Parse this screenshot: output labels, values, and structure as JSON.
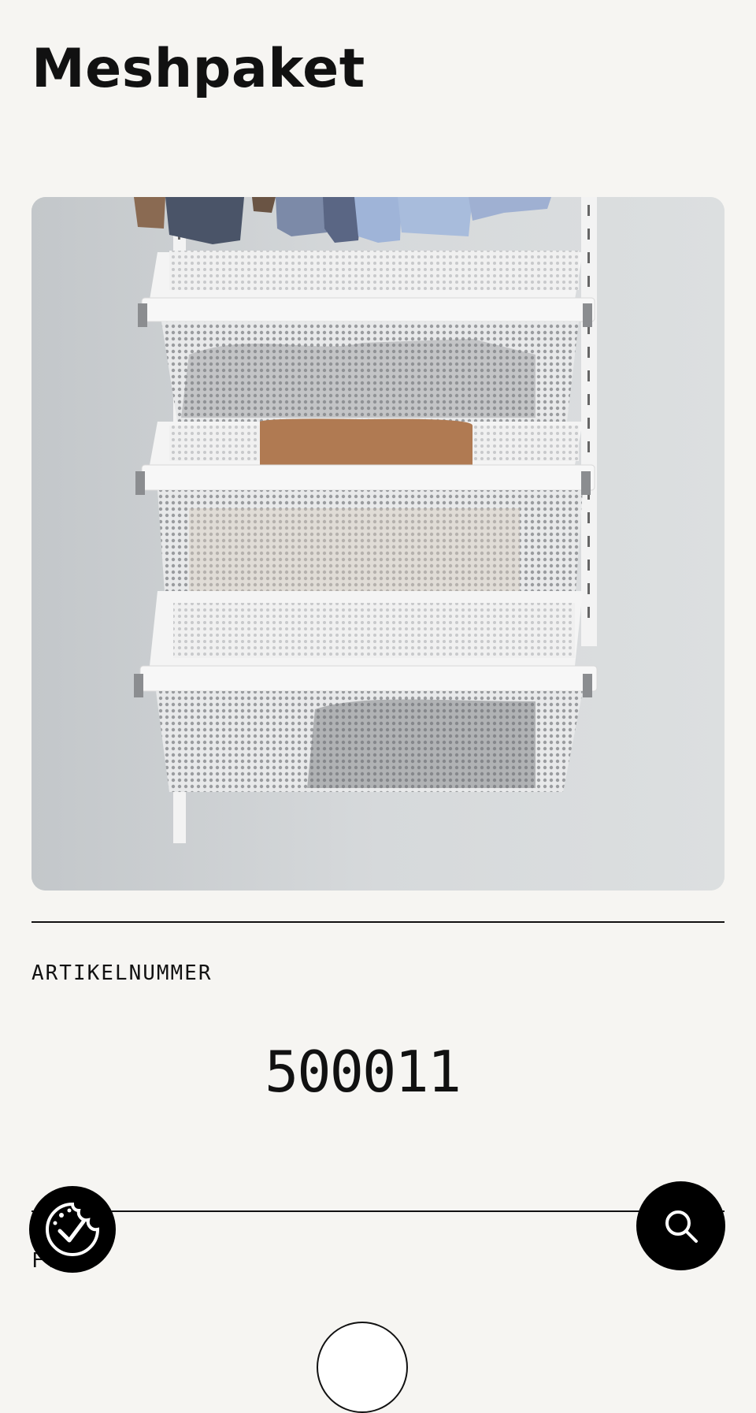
{
  "page": {
    "title": "Meshpaket"
  },
  "product": {
    "image_alt": "Meshpaket",
    "article_label": "ARTIKELNUMMER",
    "article_number": "500011",
    "next_label": "F..."
  },
  "actions": {
    "cookie_icon": "cookie-check-icon",
    "search_icon": "search-icon"
  },
  "colors": {
    "background": "#f6f5f2",
    "text": "#111111",
    "button": "#000000"
  }
}
